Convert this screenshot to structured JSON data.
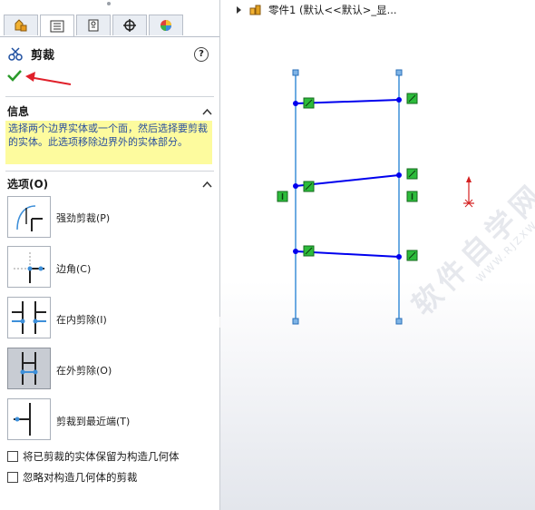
{
  "feature_manager": {
    "title": "剪裁",
    "help_label": "?",
    "tabs": [
      "feature-manager-icon",
      "property-manager-icon",
      "configuration-manager-icon",
      "dimxpert-icon",
      "display-manager-icon"
    ]
  },
  "info": {
    "header": "信息",
    "text": "选择两个边界实体或一个面，然后选择要剪裁的实体。此选项移除边界外的实体部分。"
  },
  "options": {
    "header": "选项(O)",
    "items": [
      {
        "label": "强劲剪裁(P)",
        "icon": "power-trim-icon",
        "selected": false
      },
      {
        "label": "边角(C)",
        "icon": "corner-trim-icon",
        "selected": false
      },
      {
        "label": "在内剪除(I)",
        "icon": "trim-inside-icon",
        "selected": false
      },
      {
        "label": "在外剪除(O)",
        "icon": "trim-outside-icon",
        "selected": true
      },
      {
        "label": "剪裁到最近端(T)",
        "icon": "trim-to-closest-icon",
        "selected": false
      }
    ],
    "checkboxes": [
      {
        "label": "将已剪裁的实体保留为构造几何体",
        "checked": false
      },
      {
        "label": "忽略对构造几何体的剪裁",
        "checked": false
      }
    ]
  },
  "tree": {
    "label": "零件1  (默认<<默认>_显..."
  },
  "watermark": {
    "cn": "软件自学网",
    "en": "WWW.RJZXW.COM"
  },
  "colors": {
    "sketch_line": "#0000ee",
    "construction": "#3d8fd9",
    "relation_green": "#2dbb3b",
    "info_bg": "#fdfb9e",
    "info_text": "#2a4f9e",
    "arrow_red": "#e0202a"
  }
}
